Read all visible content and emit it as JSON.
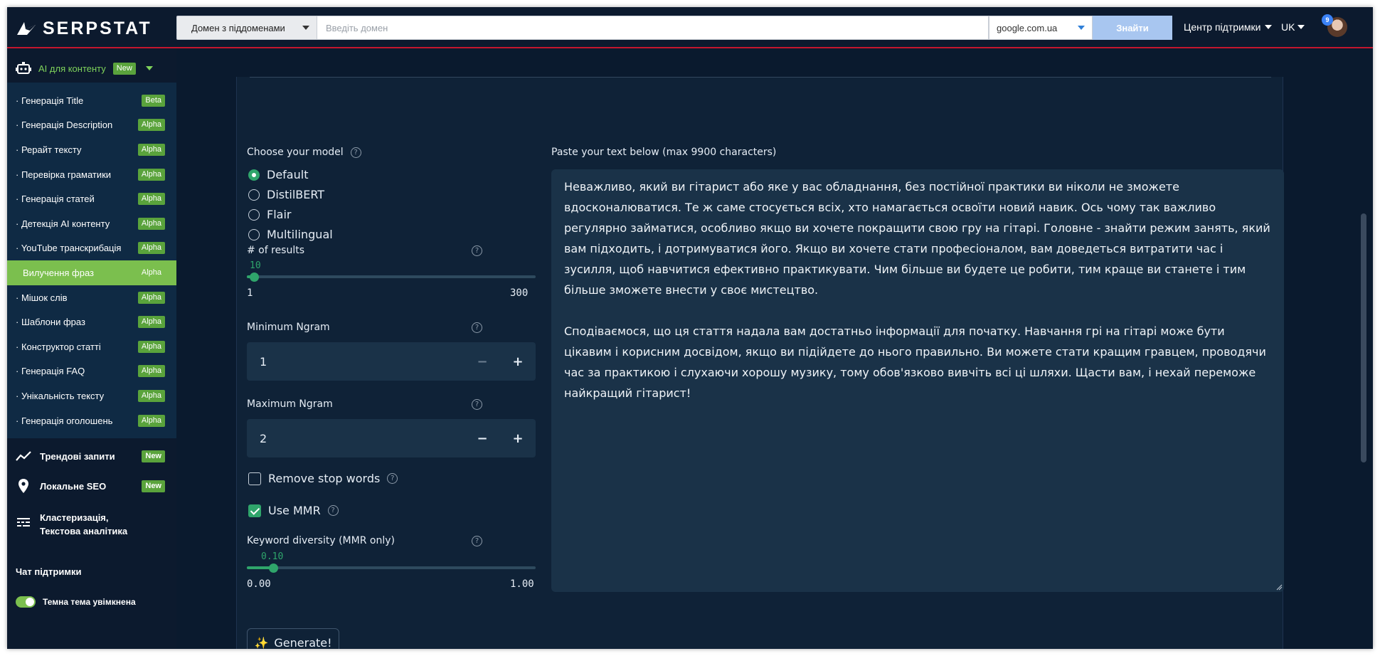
{
  "header": {
    "logo_text": "SERPSTAT",
    "scope_label": "Домен з піддоменами",
    "domain_placeholder": "Введіть домен",
    "database": "google.com.ua",
    "find_button": "Знайти",
    "support_label": "Центр підтримки",
    "language": "UK",
    "notifications": "9"
  },
  "sidebar": {
    "ai_section": {
      "label": "AI для контенту",
      "badge": "New"
    },
    "sub_items": [
      {
        "label": "· Генерація Title",
        "badge": "Beta"
      },
      {
        "label": "· Генерація Description",
        "badge": "Alpha"
      },
      {
        "label": "· Рерайт тексту",
        "badge": "Alpha"
      },
      {
        "label": "· Перевірка граматики",
        "badge": "Alpha"
      },
      {
        "label": "· Генерація статей",
        "badge": "Alpha"
      },
      {
        "label": "· Детекція AI контенту",
        "badge": "Alpha"
      },
      {
        "label": "· YouTube транскрибація",
        "badge": "Alpha"
      },
      {
        "label": "Вилучення фраз",
        "badge": "Alpha"
      },
      {
        "label": "· Мішок слів",
        "badge": "Alpha"
      },
      {
        "label": "· Шаблони фраз",
        "badge": "Alpha"
      },
      {
        "label": "· Конструктор статті",
        "badge": "Alpha"
      },
      {
        "label": "· Генерація FAQ",
        "badge": "Alpha"
      },
      {
        "label": "· Унікальність тексту",
        "badge": "Alpha"
      },
      {
        "label": "· Генерація оголошень",
        "badge": "Alpha"
      }
    ],
    "nav": [
      {
        "label": "Трендові запити",
        "badge": "New"
      },
      {
        "label": "Локальне SEO",
        "badge": "New"
      },
      {
        "label_line1": "Кластеризація,",
        "label_line2": "Текстова аналітика"
      }
    ],
    "chat_support": "Чат підтримки",
    "theme_label": "Темна тема увімкнена"
  },
  "form": {
    "model_label": "Choose your model",
    "models": [
      "Default",
      "DistilBERT",
      "Flair",
      "Multilingual"
    ],
    "selected_model": "Default",
    "results_label": "# of results",
    "results": {
      "value": "10",
      "min": "1",
      "max": "300"
    },
    "min_ngram_label": "Minimum Ngram",
    "min_ngram": "1",
    "max_ngram_label": "Maximum Ngram",
    "max_ngram": "2",
    "remove_stop_words": "Remove stop words",
    "use_mmr": "Use MMR",
    "diversity_label": "Keyword diversity (MMR only)",
    "diversity": {
      "value": "0.10",
      "min": "0.00",
      "max": "1.00"
    },
    "generate_button": "Generate!",
    "generate_icon": "✨"
  },
  "textarea": {
    "label": "Paste your text below (max 9900 characters)",
    "paragraph1": "Неважливо, який ви гітарист або яке у вас обладнання, без постійної практики ви ніколи не зможете вдосконалюватися. Те ж саме стосується всіх, хто намагається освоїти новий навик. Ось чому так важливо регулярно займатися, особливо якщо ви хочете покращити свою гру на гітарі. Головне - знайти режим занять, який вам підходить, і дотримуватися його. Якщо ви хочете стати професіоналом, вам доведеться витратити час і зусилля, щоб навчитися ефективно практикувати. Чим більше ви будете це робити, тим краще ви станете і тим більше зможете внести у своє мистецтво.",
    "paragraph2": "Сподіваємося, що ця стаття надала вам достатньо інформації для початку. Навчання грі на гітарі може бути цікавим і корисним досвідом, якщо ви підійдете до нього правильно. Ви можете стати кращим гравцем, проводячи час за практикою і слухаючи хорошу музику, тому обов'язково вивчіть всі ці шляхи. Щасти вам, і нехай переможе найкращий гітарист!"
  }
}
